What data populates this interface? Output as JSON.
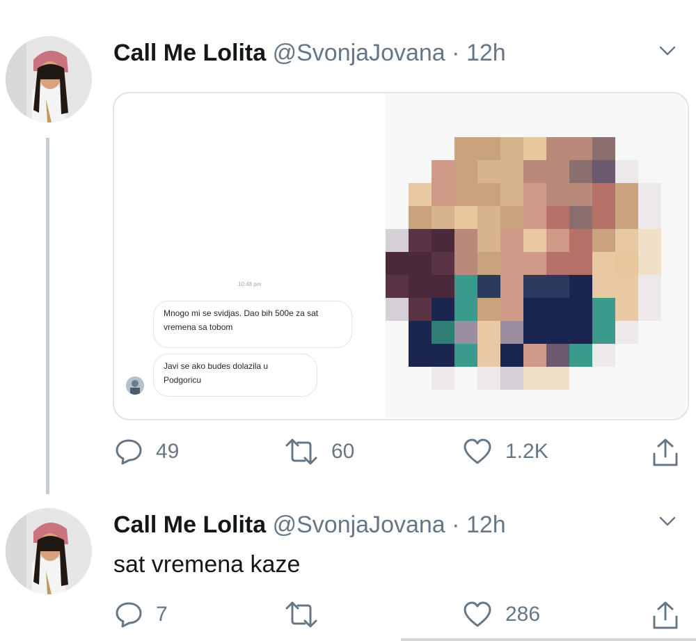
{
  "tweets": [
    {
      "author_name": "Call Me Lolita",
      "handle": "@SvonjaJovana",
      "separator": "·",
      "time": "12h",
      "text": "",
      "embedded_screenshot": {
        "timestamp": "10:48 pm",
        "messages": [
          "Mnogo mi se svidjas. Dao bih 500e za sat vremena sa tobom",
          "Javi se ako budes dolazila u Podgoricu"
        ],
        "image": "pixelated-photo"
      },
      "counts": {
        "replies": "49",
        "retweets": "60",
        "likes": "1.2K"
      }
    },
    {
      "author_name": "Call Me Lolita",
      "handle": "@SvonjaJovana",
      "separator": "·",
      "time": "12h",
      "text": "sat vremena kaze",
      "counts": {
        "replies": "7",
        "retweets": "",
        "likes": "286"
      }
    }
  ],
  "icons": {
    "reply": "reply-icon",
    "retweet": "retweet-icon",
    "like": "heart-icon",
    "share": "share-icon",
    "more": "chevron-down-icon"
  },
  "colors": {
    "text": "#14171a",
    "secondary": "#657786",
    "thread_line": "#c5ced6",
    "border": "#dfe4e8"
  }
}
